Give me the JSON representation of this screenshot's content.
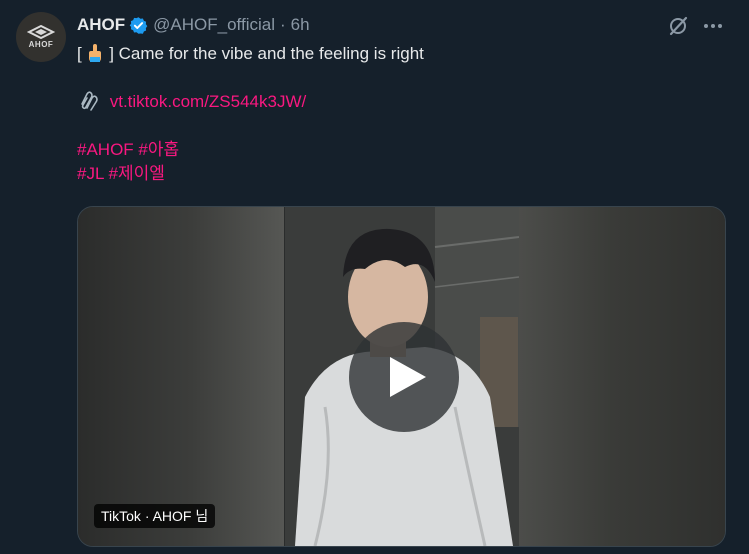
{
  "account": {
    "avatar_text": "AHOF",
    "display_name": "AHOF",
    "handle": "@AHOF_official",
    "separator": "·",
    "timestamp": "6h",
    "verified_icon": "verified-badge-icon"
  },
  "tweet": {
    "line1_open": "[",
    "line1_emoji": "pointing-hand-emoji",
    "line1_text": "] Came for the vibe and the feeling is right",
    "link_icon": "paperclip-icon",
    "link_text": "vt.tiktok.com/ZS544k3JW/",
    "hashtags_row1": [
      "#AHOF",
      "#아홉"
    ],
    "hashtags_row2": [
      "#JL",
      "#제이엘"
    ]
  },
  "media": {
    "source_label": "TikTok · AHOF 님",
    "play_icon": "play-icon"
  },
  "actions": {
    "grok_icon": "grok-icon",
    "more_icon": "more-icon"
  },
  "colors": {
    "background": "#15202b",
    "accent": "#f91880",
    "verified": "#1d9bf0",
    "muted": "#8b98a5"
  }
}
